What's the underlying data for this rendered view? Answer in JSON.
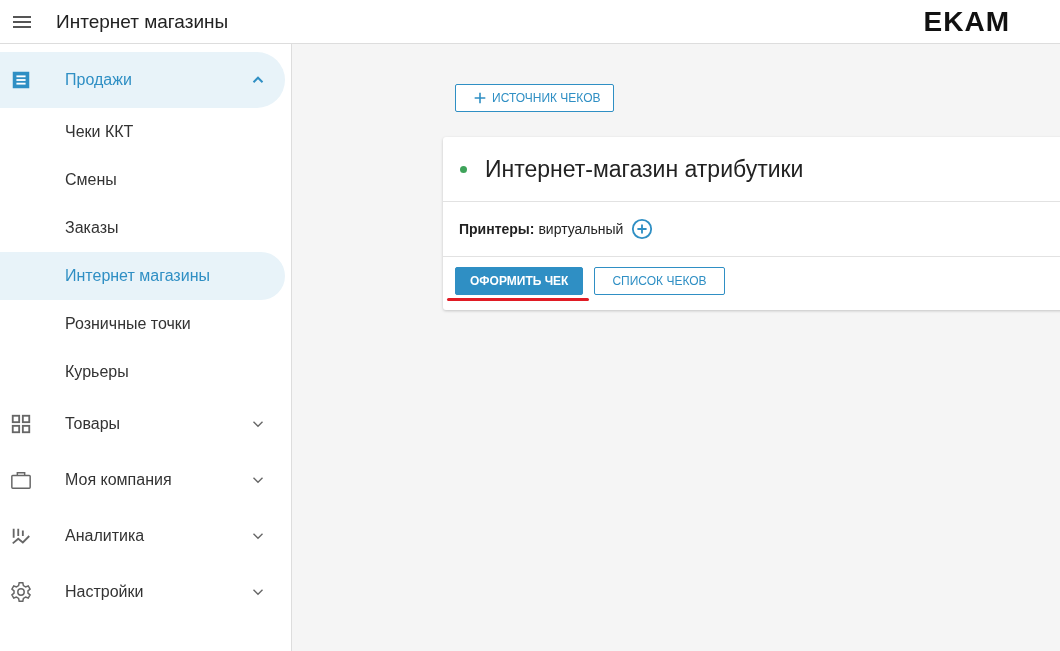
{
  "header": {
    "title": "Интернет магазины",
    "logo": "EKAM"
  },
  "sidebar": {
    "items": [
      {
        "label": "Продажи",
        "expanded": true,
        "selected": false,
        "children": [
          {
            "label": "Чеки ККТ",
            "selected": false
          },
          {
            "label": "Смены",
            "selected": false
          },
          {
            "label": "Заказы",
            "selected": false
          },
          {
            "label": "Интернет магазины",
            "selected": true
          },
          {
            "label": "Розничные точки",
            "selected": false
          },
          {
            "label": "Курьеры",
            "selected": false
          }
        ]
      },
      {
        "label": "Товары",
        "expanded": false,
        "selected": false
      },
      {
        "label": "Моя компания",
        "expanded": false,
        "selected": false
      },
      {
        "label": "Аналитика",
        "expanded": false,
        "selected": false
      },
      {
        "label": "Настройки",
        "expanded": false,
        "selected": false
      }
    ]
  },
  "toolbar": {
    "add_button": "ИСТОЧНИК ЧЕКОВ"
  },
  "store": {
    "title": "Интернет-магазин атрибутики",
    "online": true,
    "printers_label": "Принтеры:",
    "printers_value": "виртуальный",
    "actions": [
      {
        "label": "ОФОРМИТЬ ЧЕК",
        "kind": "primary",
        "highlighted": true
      },
      {
        "label": "СПИСОК ЧЕКОВ",
        "kind": "outlined",
        "highlighted": false
      }
    ]
  }
}
